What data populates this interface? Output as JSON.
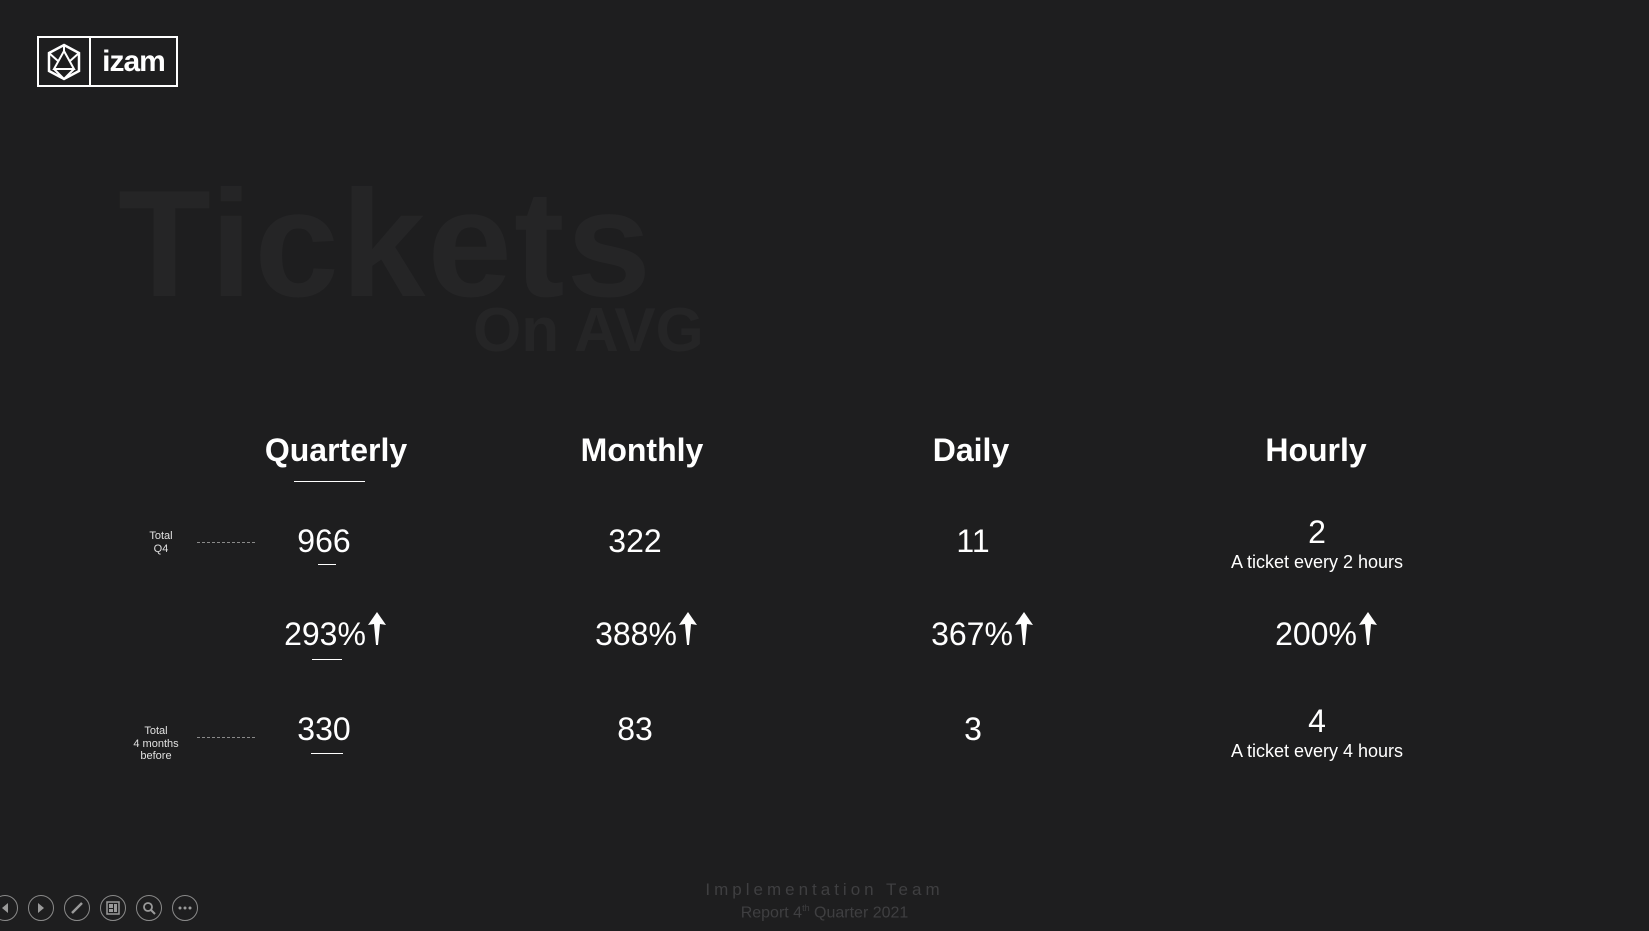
{
  "logo": {
    "text": "izam"
  },
  "title": {
    "main": "Tickets",
    "sub": "On AVG"
  },
  "columns": [
    {
      "key": "quarterly",
      "label": "Quarterly"
    },
    {
      "key": "monthly",
      "label": "Monthly"
    },
    {
      "key": "daily",
      "label": "Daily"
    },
    {
      "key": "hourly",
      "label": "Hourly"
    }
  ],
  "rows": {
    "current": {
      "label_line1": "Total",
      "label_line2": "Q4",
      "values": [
        "966",
        "322",
        "11",
        "2"
      ],
      "hourly_note": "A ticket every 2 hours"
    },
    "growth": {
      "values": [
        "293%",
        "388%",
        "367%",
        "200%"
      ]
    },
    "previous": {
      "label_line1": "Total",
      "label_line2": "4 months",
      "label_line3": "before",
      "values": [
        "330",
        "83",
        "3",
        "4"
      ],
      "hourly_note": "A ticket every 4 hours"
    }
  },
  "footer": {
    "team": "Implementation Team",
    "report_prefix": "Report 4",
    "report_sup": "th",
    "report_suffix": " Quarter 2021"
  },
  "controls": [
    {
      "icon": "previous-slide-icon"
    },
    {
      "icon": "next-slide-icon"
    },
    {
      "icon": "pen-icon"
    },
    {
      "icon": "slides-grid-icon"
    },
    {
      "icon": "zoom-icon"
    },
    {
      "icon": "more-options-icon"
    }
  ]
}
